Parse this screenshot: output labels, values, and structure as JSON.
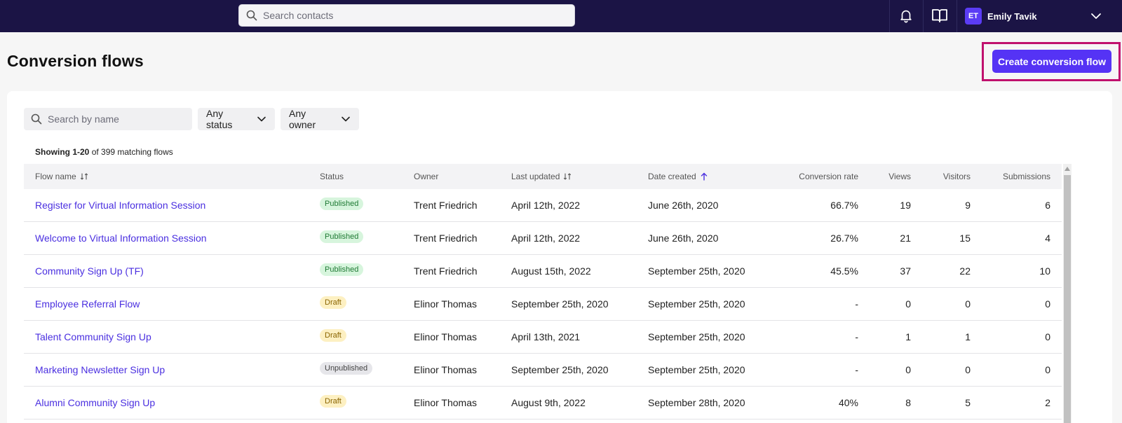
{
  "topbar": {
    "search_placeholder": "Search contacts",
    "user_initials": "ET",
    "user_name": "Emily Tavik",
    "colors": {
      "background": "#1b1445",
      "avatar": "#5b3cf5"
    }
  },
  "header": {
    "title": "Conversion flows",
    "create_button": "Create conversion flow",
    "accent": "#5533f5",
    "highlight_border": "#c0116e"
  },
  "filters": {
    "name_search_placeholder": "Search by name",
    "status": "Any status",
    "owner": "Any owner"
  },
  "summary": {
    "range": "Showing 1-20",
    "of_text": "of 399 matching flows"
  },
  "table": {
    "columns": {
      "flow_name": "Flow name",
      "status": "Status",
      "owner": "Owner",
      "last_updated": "Last updated",
      "date_created": "Date created",
      "conversion_rate": "Conversion rate",
      "views": "Views",
      "visitors": "Visitors",
      "submissions": "Submissions"
    },
    "rows": [
      {
        "name": "Register for Virtual Information Session",
        "status": "Published",
        "owner": "Trent Friedrich",
        "last_updated": "April 12th, 2022",
        "date_created": "June 26th, 2020",
        "conversion_rate": "66.7%",
        "views": "19",
        "visitors": "9",
        "submissions": "6"
      },
      {
        "name": "Welcome to Virtual Information Session",
        "status": "Published",
        "owner": "Trent Friedrich",
        "last_updated": "April 12th, 2022",
        "date_created": "June 26th, 2020",
        "conversion_rate": "26.7%",
        "views": "21",
        "visitors": "15",
        "submissions": "4"
      },
      {
        "name": "Community Sign Up (TF)",
        "status": "Published",
        "owner": "Trent Friedrich",
        "last_updated": "August 15th, 2022",
        "date_created": "September 25th, 2020",
        "conversion_rate": "45.5%",
        "views": "37",
        "visitors": "22",
        "submissions": "10"
      },
      {
        "name": "Employee Referral Flow",
        "status": "Draft",
        "owner": "Elinor Thomas",
        "last_updated": "September 25th, 2020",
        "date_created": "September 25th, 2020",
        "conversion_rate": "-",
        "views": "0",
        "visitors": "0",
        "submissions": "0"
      },
      {
        "name": "Talent Community Sign Up",
        "status": "Draft",
        "owner": "Elinor Thomas",
        "last_updated": "April 13th, 2021",
        "date_created": "September 25th, 2020",
        "conversion_rate": "-",
        "views": "1",
        "visitors": "1",
        "submissions": "0"
      },
      {
        "name": "Marketing Newsletter Sign Up",
        "status": "Unpublished",
        "owner": "Elinor Thomas",
        "last_updated": "September 25th, 2020",
        "date_created": "September 25th, 2020",
        "conversion_rate": "-",
        "views": "0",
        "visitors": "0",
        "submissions": "0"
      },
      {
        "name": "Alumni Community Sign Up",
        "status": "Draft",
        "owner": "Elinor Thomas",
        "last_updated": "August 9th, 2022",
        "date_created": "September 28th, 2020",
        "conversion_rate": "40%",
        "views": "8",
        "visitors": "5",
        "submissions": "2"
      }
    ]
  },
  "icons": {
    "search": "search-icon",
    "bell": "bell-icon",
    "book": "book-icon",
    "chevron": "chevron-down-icon",
    "sort": "sort-icon",
    "sort_asc": "arrow-up-icon"
  }
}
